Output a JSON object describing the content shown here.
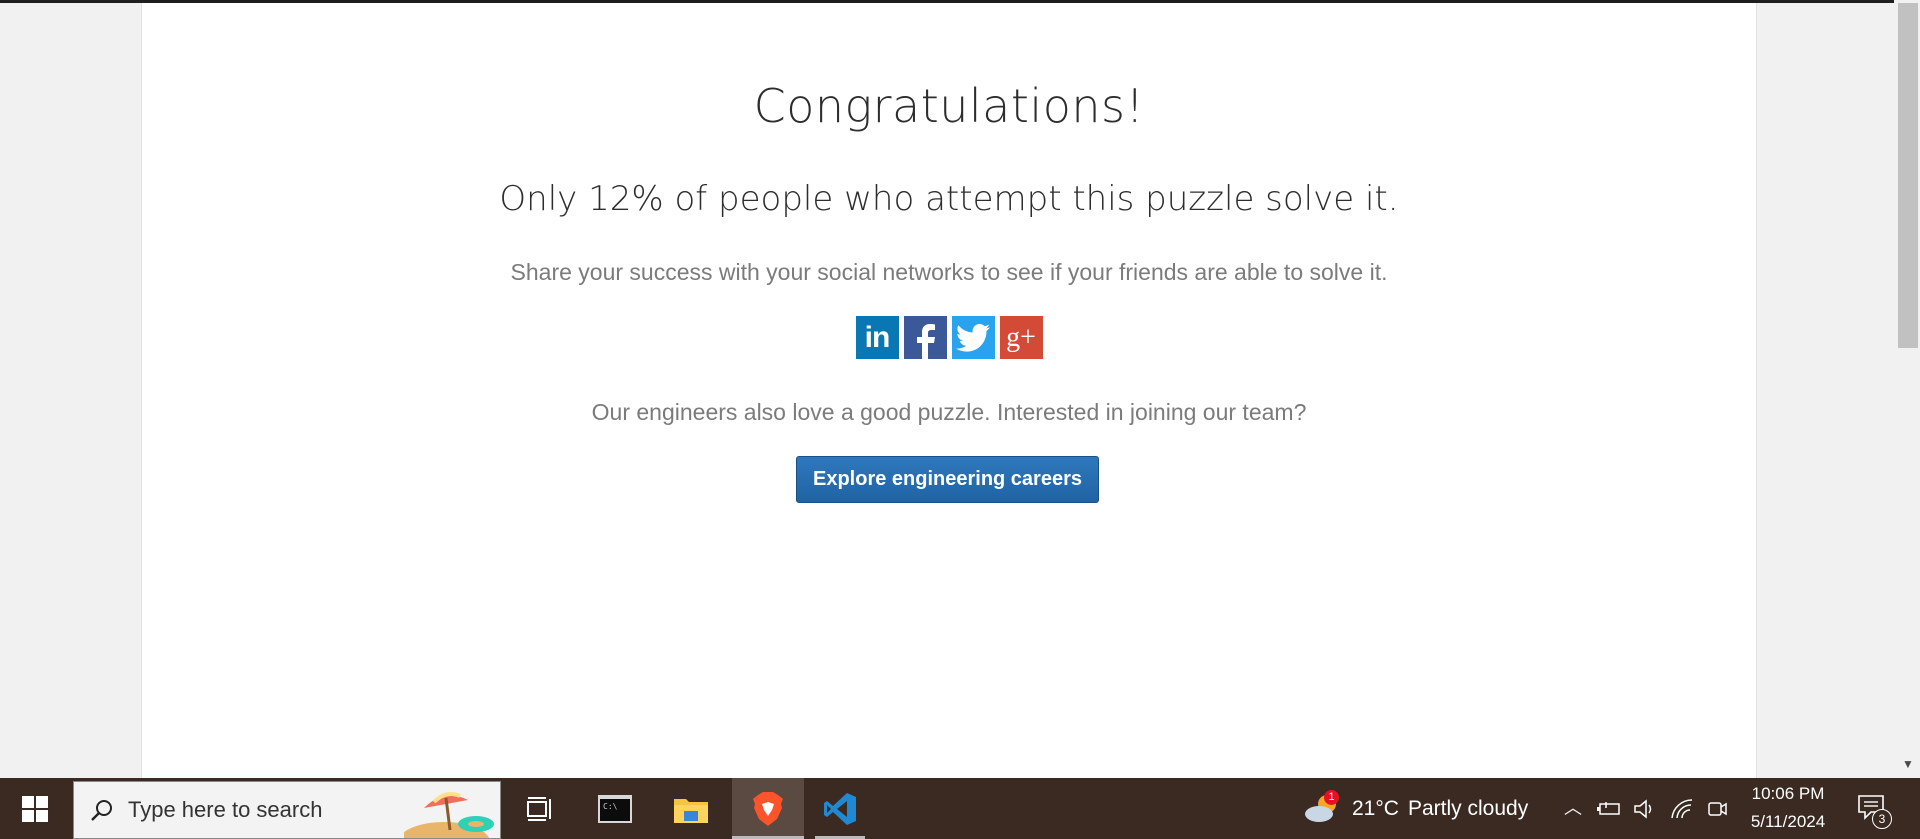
{
  "content": {
    "heading": "Congratulations!",
    "subheading": "Only 12% of people who attempt this puzzle solve it.",
    "share_text": "Share your success with your social networks to see if your friends are able to solve it.",
    "social": {
      "linkedin_label": "in",
      "googleplus_label": "g+"
    },
    "engineers_text": "Our engineers also love a good puzzle. Interested in joining our team?",
    "cta_label": "Explore engineering careers"
  },
  "colors": {
    "cta": "#1f63a4",
    "linkedin": "#0a77b5",
    "facebook": "#3b5998",
    "twitter": "#2aa3ef",
    "googleplus": "#d34a37",
    "taskbar": "#3a2a22"
  },
  "taskbar": {
    "search_placeholder": "Type here to search",
    "weather_temp": "21°C",
    "weather_desc": "Partly cloudy",
    "weather_badge": "1",
    "time": "10:06 PM",
    "date": "5/11/2024",
    "notification_count": "3",
    "apps": [
      "windows-start-icon",
      "task-view-icon",
      "terminal-icon",
      "file-explorer-icon",
      "brave-browser-icon",
      "vscode-icon"
    ]
  }
}
